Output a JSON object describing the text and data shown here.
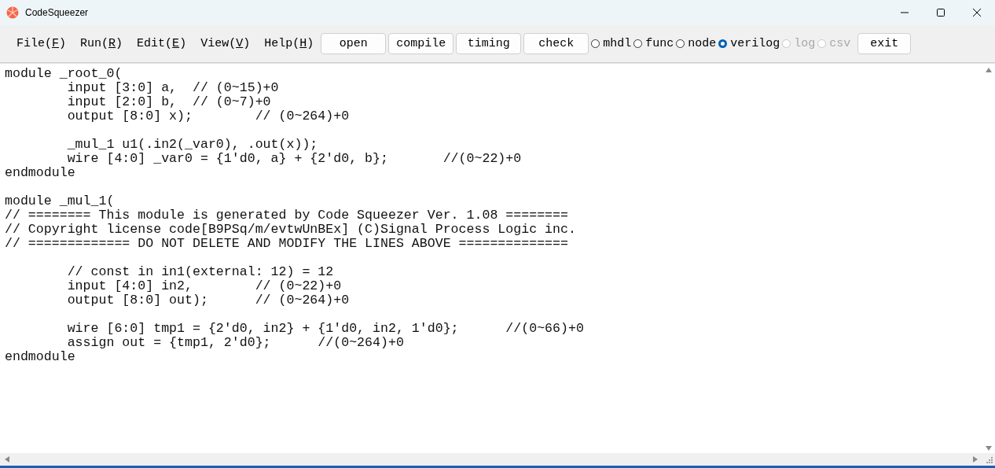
{
  "window": {
    "title": "CodeSqueezer"
  },
  "menu": [
    {
      "before": "File(",
      "key": "F",
      "after": ")"
    },
    {
      "before": "Run(",
      "key": "R",
      "after": ")"
    },
    {
      "before": "Edit(",
      "key": "E",
      "after": ")"
    },
    {
      "before": "View(",
      "key": "V",
      "after": ")"
    },
    {
      "before": "Help(",
      "key": "H",
      "after": ")"
    }
  ],
  "buttons": [
    "open",
    "compile",
    "timing",
    "check"
  ],
  "modes": [
    {
      "label": "mhdl",
      "selected": false,
      "disabled": false
    },
    {
      "label": "func",
      "selected": false,
      "disabled": false
    },
    {
      "label": "node",
      "selected": false,
      "disabled": false
    },
    {
      "label": "verilog",
      "selected": true,
      "disabled": false
    },
    {
      "label": "log",
      "selected": false,
      "disabled": true
    },
    {
      "label": "csv",
      "selected": false,
      "disabled": true
    }
  ],
  "exit_button": "exit",
  "editor": {
    "blocks": [
      [
        "module _root_0(",
        "        input [3:0] a,  // (0~15)+0",
        "        input [2:0] b,  // (0~7)+0",
        "        output [8:0] x);        // (0~264)+0"
      ],
      [
        "        _mul_1 u1(.in2(_var0), .out(x));",
        "        wire [4:0] _var0 = {1'd0, a} + {2'd0, b};       //(0~22)+0",
        "endmodule"
      ],
      [
        "module _mul_1(",
        "// ======== This module is generated by Code Squeezer Ver. 1.08 ========",
        "// Copyright license code[B9PSq/m/evtwUnBEx] (C)Signal Process Logic inc.",
        "// ============= DO NOT DELETE AND MODIFY THE LINES ABOVE =============="
      ],
      [
        "        // const in in1(external: 12) = 12",
        "        input [4:0] in2,        // (0~22)+0",
        "        output [8:0] out);      // (0~264)+0"
      ],
      [
        "        wire [6:0] tmp1 = {2'd0, in2} + {1'd0, in2, 1'd0};      //(0~66)+0",
        "        assign out = {tmp1, 2'd0};      //(0~264)+0",
        "endmodule"
      ]
    ]
  }
}
